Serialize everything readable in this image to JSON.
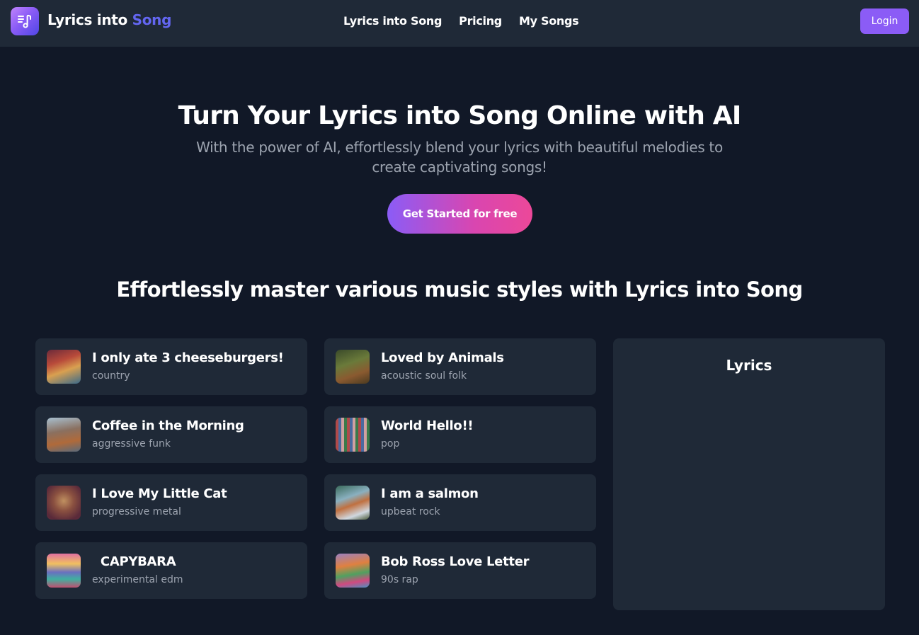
{
  "header": {
    "brand_main": "Lyrics into",
    "brand_accent": "Song",
    "nav": [
      {
        "label": "Lyrics into Song"
      },
      {
        "label": "Pricing"
      },
      {
        "label": "My Songs"
      }
    ],
    "login_label": "Login",
    "logo_icon": "music-lyrics-icon"
  },
  "hero": {
    "title": "Turn Your Lyrics into Song Online with AI",
    "subtitle": "With the power of AI, effortlessly blend your lyrics with beautiful melodies to create captivating songs!",
    "cta_label": "Get Started for free"
  },
  "styles_section": {
    "title": "Effortlessly master various music styles with Lyrics into Song",
    "songs": [
      {
        "title": "I only ate 3 cheeseburgers!",
        "style": "country",
        "thumb": "cheeseburger-diner-art"
      },
      {
        "title": "Loved by Animals",
        "style": "acoustic soul folk",
        "thumb": "forest-animals-art"
      },
      {
        "title": "Coffee in the Morning",
        "style": "aggressive funk",
        "thumb": "coffee-city-art"
      },
      {
        "title": "World Hello!!",
        "style": "pop",
        "thumb": "world-flags-art"
      },
      {
        "title": "I Love My Little Cat",
        "style": "progressive metal",
        "thumb": "cat-portrait-art"
      },
      {
        "title": "I am a salmon",
        "style": "upbeat rock",
        "thumb": "salmon-waterfall-art"
      },
      {
        "title": "  CAPYBARA",
        "style": "experimental edm",
        "thumb": "capybara-landscape-art"
      },
      {
        "title": "Bob Ross Love Letter",
        "style": "90s rap",
        "thumb": "painted-landscape-art"
      }
    ]
  },
  "lyrics_panel": {
    "title": "Lyrics"
  },
  "colors": {
    "background": "#111827",
    "surface": "#1f2937",
    "accent": "#8b5cf6",
    "brand_accent": "#6366f1",
    "cta_end": "#ec4899",
    "muted_text": "#9ca3af"
  }
}
